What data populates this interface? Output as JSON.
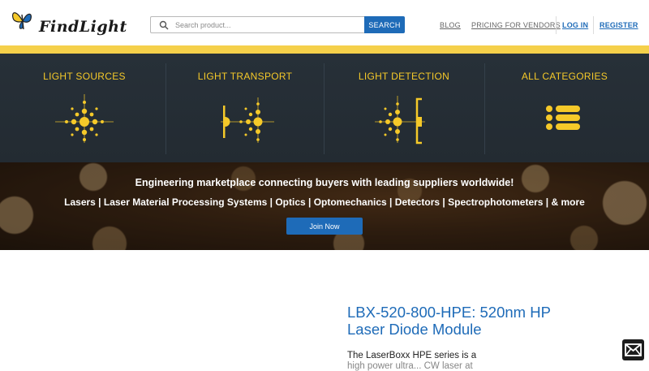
{
  "header": {
    "logo_text": "FindLight",
    "search": {
      "placeholder": "Search product...",
      "value": ""
    },
    "search_button": "SEARCH",
    "nav": {
      "blog": "BLOG",
      "pricing": "PRICING FOR VENDORS",
      "login": "LOG IN",
      "register": "REGISTER"
    }
  },
  "categories": [
    {
      "label": "LIGHT SOURCES",
      "icon": "light-sources-icon"
    },
    {
      "label": "LIGHT TRANSPORT",
      "icon": "light-transport-icon"
    },
    {
      "label": "LIGHT DETECTION",
      "icon": "light-detection-icon"
    },
    {
      "label": "ALL CATEGORIES",
      "icon": "list-icon"
    }
  ],
  "hero": {
    "title": "Engineering marketplace connecting buyers with leading suppliers worldwide!",
    "subtitle": "Lasers | Laser Material Processing Systems | Optics | Optomechanics | Detectors | Spectrophotometers | & more",
    "join_button": "Join Now"
  },
  "product": {
    "title": "LBX-520-800-HPE: 520nm HP Laser Diode Module",
    "description": "The LaserBoxx HPE series is a",
    "description_cont": "high power ultra... CW laser at"
  },
  "colors": {
    "accent_blue": "#1e6bb8",
    "accent_yellow": "#f5c929",
    "category_bg": "#273038"
  }
}
